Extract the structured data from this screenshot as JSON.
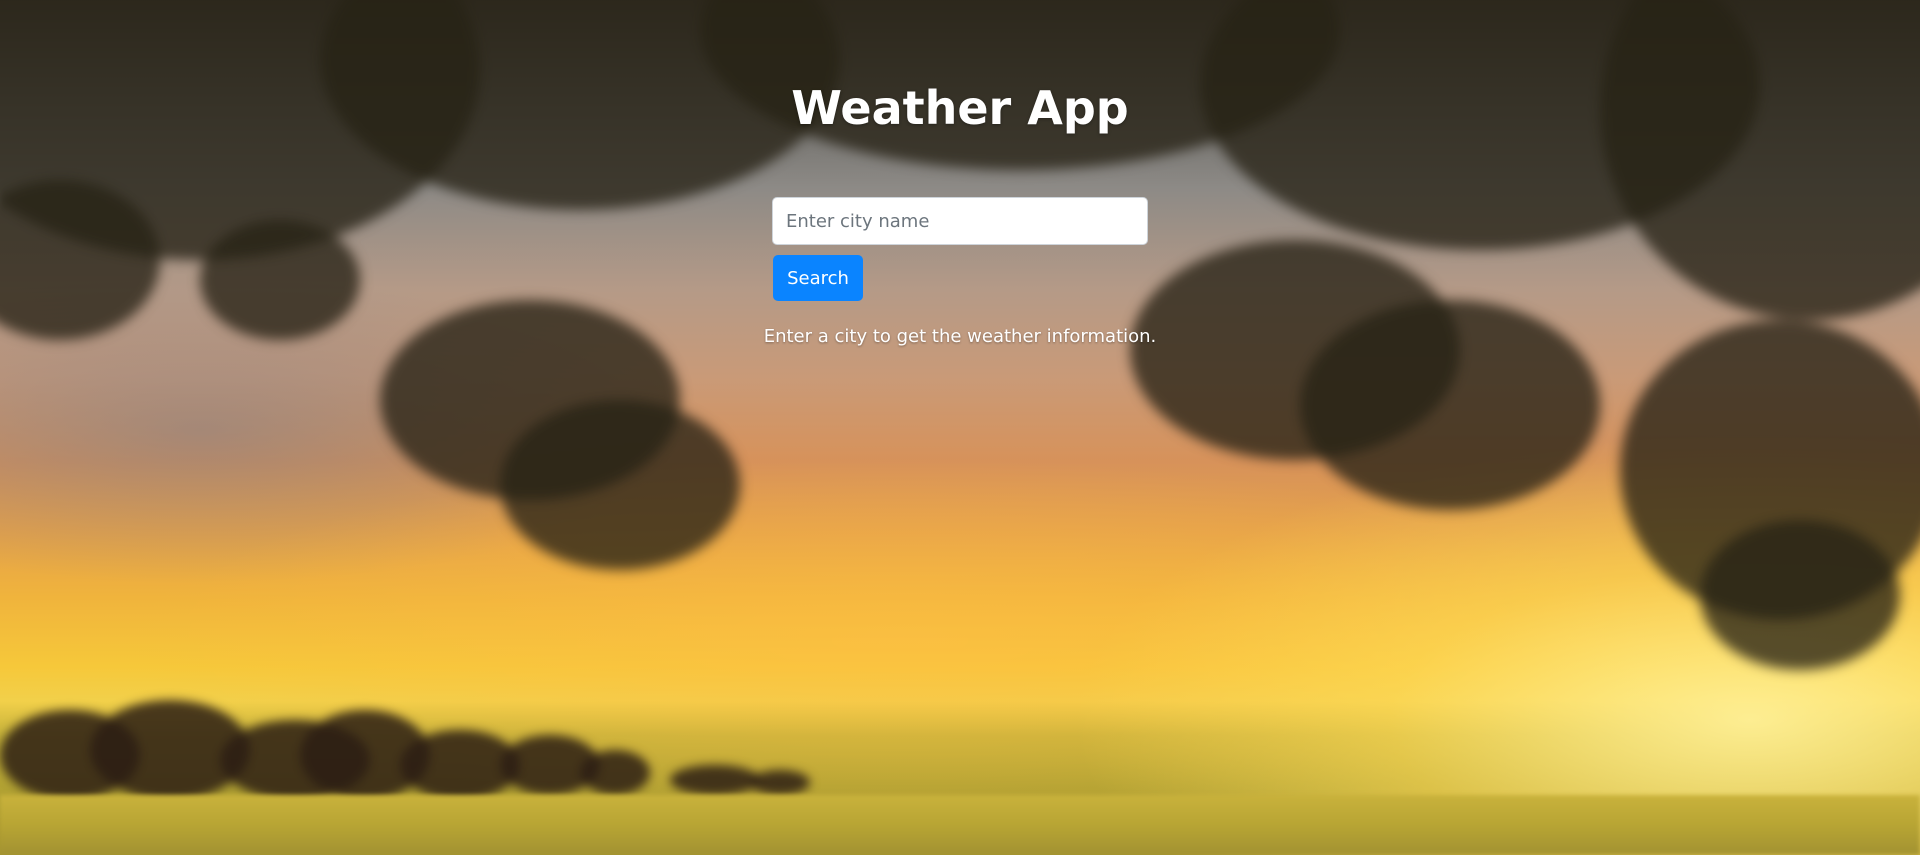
{
  "app": {
    "title": "Weather App"
  },
  "search": {
    "placeholder": "Enter city name",
    "value": "",
    "button_label": "Search"
  },
  "status": {
    "message": "Enter a city to get the weather information."
  },
  "colors": {
    "button_bg": "#0a84ff",
    "title_text": "#ffffff"
  }
}
